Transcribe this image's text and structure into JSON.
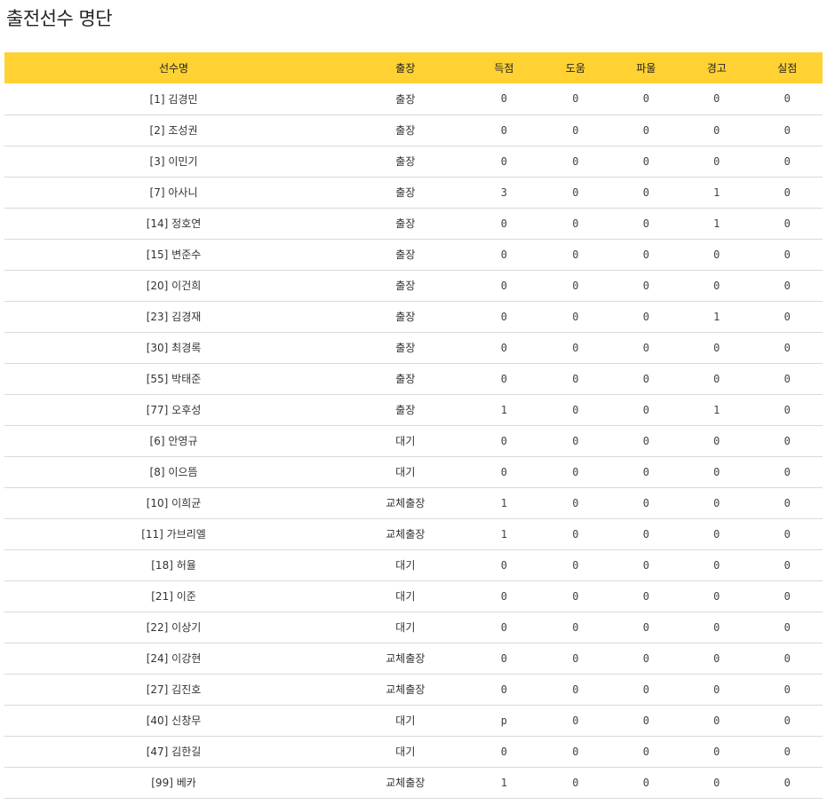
{
  "page": {
    "title": "출전선수 명단"
  },
  "table": {
    "headers": {
      "name": "선수명",
      "status": "출장",
      "goals": "득점",
      "assists": "도움",
      "fouls": "파울",
      "warnings": "경고",
      "own_goals": "실점"
    },
    "rows": [
      {
        "name": "[1] 김경민",
        "status": "출장",
        "goals": "0",
        "assists": "0",
        "fouls": "0",
        "warnings": "0",
        "own_goals": "0"
      },
      {
        "name": "[2] 조성권",
        "status": "출장",
        "goals": "0",
        "assists": "0",
        "fouls": "0",
        "warnings": "0",
        "own_goals": "0"
      },
      {
        "name": "[3] 이민기",
        "status": "출장",
        "goals": "0",
        "assists": "0",
        "fouls": "0",
        "warnings": "0",
        "own_goals": "0"
      },
      {
        "name": "[7] 아사니",
        "status": "출장",
        "goals": "3",
        "assists": "0",
        "fouls": "0",
        "warnings": "1",
        "own_goals": "0"
      },
      {
        "name": "[14] 정호연",
        "status": "출장",
        "goals": "0",
        "assists": "0",
        "fouls": "0",
        "warnings": "1",
        "own_goals": "0"
      },
      {
        "name": "[15] 변준수",
        "status": "출장",
        "goals": "0",
        "assists": "0",
        "fouls": "0",
        "warnings": "0",
        "own_goals": "0"
      },
      {
        "name": "[20] 이건희",
        "status": "출장",
        "goals": "0",
        "assists": "0",
        "fouls": "0",
        "warnings": "0",
        "own_goals": "0"
      },
      {
        "name": "[23] 김경재",
        "status": "출장",
        "goals": "0",
        "assists": "0",
        "fouls": "0",
        "warnings": "1",
        "own_goals": "0"
      },
      {
        "name": "[30] 최경록",
        "status": "출장",
        "goals": "0",
        "assists": "0",
        "fouls": "0",
        "warnings": "0",
        "own_goals": "0"
      },
      {
        "name": "[55] 박태준",
        "status": "출장",
        "goals": "0",
        "assists": "0",
        "fouls": "0",
        "warnings": "0",
        "own_goals": "0"
      },
      {
        "name": "[77] 오후성",
        "status": "출장",
        "goals": "1",
        "assists": "0",
        "fouls": "0",
        "warnings": "1",
        "own_goals": "0"
      },
      {
        "name": "[6] 안영규",
        "status": "대기",
        "goals": "0",
        "assists": "0",
        "fouls": "0",
        "warnings": "0",
        "own_goals": "0"
      },
      {
        "name": "[8] 이으뜸",
        "status": "대기",
        "goals": "0",
        "assists": "0",
        "fouls": "0",
        "warnings": "0",
        "own_goals": "0"
      },
      {
        "name": "[10] 이희균",
        "status": "교체출장",
        "goals": "1",
        "assists": "0",
        "fouls": "0",
        "warnings": "0",
        "own_goals": "0"
      },
      {
        "name": "[11] 가브리엘",
        "status": "교체출장",
        "goals": "1",
        "assists": "0",
        "fouls": "0",
        "warnings": "0",
        "own_goals": "0"
      },
      {
        "name": "[18] 허율",
        "status": "대기",
        "goals": "0",
        "assists": "0",
        "fouls": "0",
        "warnings": "0",
        "own_goals": "0"
      },
      {
        "name": "[21] 이준",
        "status": "대기",
        "goals": "0",
        "assists": "0",
        "fouls": "0",
        "warnings": "0",
        "own_goals": "0"
      },
      {
        "name": "[22] 이상기",
        "status": "대기",
        "goals": "0",
        "assists": "0",
        "fouls": "0",
        "warnings": "0",
        "own_goals": "0"
      },
      {
        "name": "[24] 이강현",
        "status": "교체출장",
        "goals": "0",
        "assists": "0",
        "fouls": "0",
        "warnings": "0",
        "own_goals": "0"
      },
      {
        "name": "[27] 김진호",
        "status": "교체출장",
        "goals": "0",
        "assists": "0",
        "fouls": "0",
        "warnings": "0",
        "own_goals": "0"
      },
      {
        "name": "[40] 신창무",
        "status": "대기",
        "goals": "p",
        "assists": "0",
        "fouls": "0",
        "warnings": "0",
        "own_goals": "0"
      },
      {
        "name": "[47] 김한길",
        "status": "대기",
        "goals": "0",
        "assists": "0",
        "fouls": "0",
        "warnings": "0",
        "own_goals": "0"
      },
      {
        "name": "[99] 베카",
        "status": "교체출장",
        "goals": "1",
        "assists": "0",
        "fouls": "0",
        "warnings": "0",
        "own_goals": "0"
      }
    ]
  },
  "colors": {
    "header_bg": "#ffd133",
    "row_border": "#d9d9d9",
    "text": "#333333"
  }
}
